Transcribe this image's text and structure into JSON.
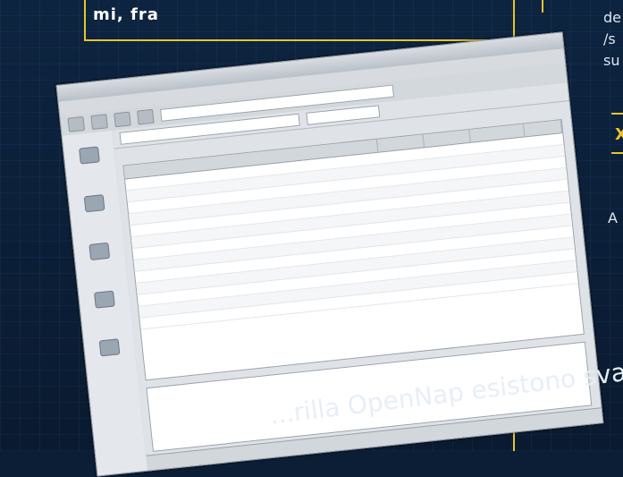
{
  "magazine": {
    "top_text": "mi,    fra",
    "right_text_lines": [
      "de",
      "/s",
      "su"
    ],
    "x_label": "X",
    "right_small_text": "A",
    "bottom_text": "...rilla OpenNap esistono svariati"
  },
  "app": {
    "window_title": "",
    "menu_items": [],
    "sidebar_items": [
      {
        "label": ""
      },
      {
        "label": ""
      },
      {
        "label": ""
      },
      {
        "label": ""
      },
      {
        "label": ""
      }
    ],
    "table": {
      "columns": [],
      "rows": []
    }
  },
  "colors": {
    "accent_yellow": "#e7c52c",
    "background": "#0b1e36"
  }
}
